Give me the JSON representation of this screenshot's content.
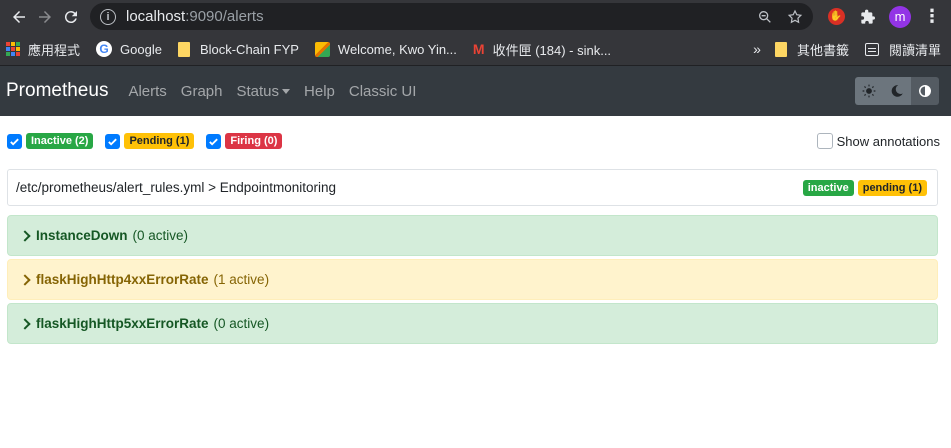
{
  "browser": {
    "url_host": "localhost",
    "url_path": ":9090/alerts",
    "avatar_letter": "m",
    "bookmarks": [
      {
        "label": "應用程式"
      },
      {
        "label": "Google"
      },
      {
        "label": "Block-Chain FYP"
      },
      {
        "label": "Welcome, Kwo Yin..."
      },
      {
        "label": "收件匣 (184) - sink..."
      }
    ],
    "overflow_label": "»",
    "other_bookmarks": "其他書籤",
    "reading_list": "閱讀清單"
  },
  "nav": {
    "brand": "Prometheus",
    "links": [
      "Alerts",
      "Graph",
      "Status",
      "Help",
      "Classic UI"
    ]
  },
  "filters": {
    "inactive": "Inactive (2)",
    "pending": "Pending (1)",
    "firing": "Firing (0)",
    "show_annotations": "Show annotations"
  },
  "group": {
    "path": "/etc/prometheus/alert_rules.yml > Endpointmonitoring",
    "badge_inactive": "inactive",
    "badge_pending": "pending (1)"
  },
  "rules": [
    {
      "name": "InstanceDown",
      "count": "(0 active)",
      "state": "inactive"
    },
    {
      "name": "flaskHighHttp4xxErrorRate",
      "count": "(1 active)",
      "state": "pending"
    },
    {
      "name": "flaskHighHttp5xxErrorRate",
      "count": "(0 active)",
      "state": "inactive"
    }
  ],
  "colors": {
    "navbar": "#343a40",
    "success": "#28a745",
    "warning": "#ffc107",
    "danger": "#dc3545",
    "primary": "#007bff"
  }
}
